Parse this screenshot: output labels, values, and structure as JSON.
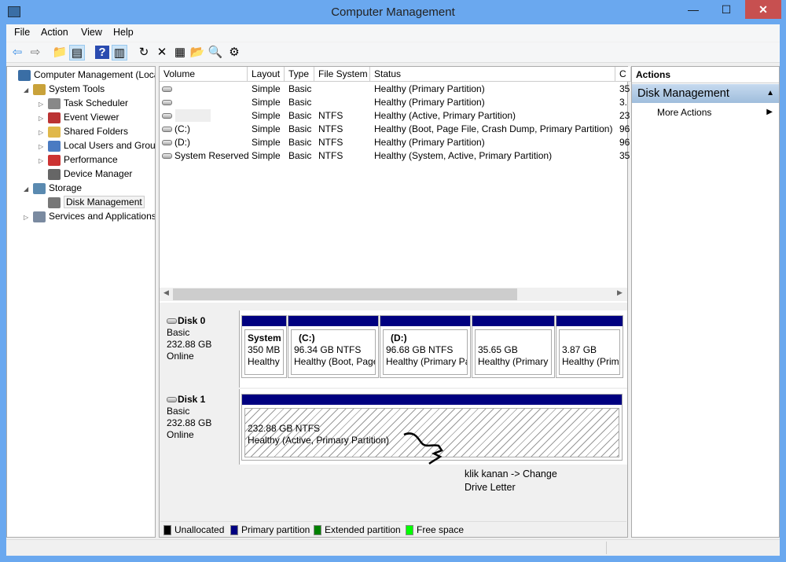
{
  "window": {
    "title": "Computer Management",
    "minimize": "—",
    "maximize": "☐",
    "close": "✕"
  },
  "menu": [
    "File",
    "Action",
    "View",
    "Help"
  ],
  "toolbar": [
    {
      "icon": "back-arrow-icon",
      "glyph": "⇦"
    },
    {
      "icon": "forward-arrow-icon",
      "glyph": "⇨"
    },
    {
      "icon": "up-folder-icon",
      "glyph": "📁"
    },
    {
      "icon": "show-hide-tree-icon",
      "glyph": "▤"
    },
    {
      "icon": "help-icon",
      "glyph": "?"
    },
    {
      "icon": "show-hide-action-pane-icon",
      "glyph": "▥"
    },
    {
      "icon": "refresh-icon",
      "glyph": "↻"
    },
    {
      "icon": "delete-icon",
      "glyph": "✕"
    },
    {
      "icon": "properties-icon",
      "glyph": "▦"
    },
    {
      "icon": "open-folder-icon",
      "glyph": "📂"
    },
    {
      "icon": "search-icon",
      "glyph": "🔍"
    },
    {
      "icon": "settings-icon",
      "glyph": "⚙"
    }
  ],
  "tree": [
    {
      "label": "Computer Management (Local",
      "level": 0,
      "tw": "",
      "icon": "computer-icon",
      "color": "#3a6ea5"
    },
    {
      "label": "System Tools",
      "level": 1,
      "tw": "◢",
      "icon": "tools-icon",
      "color": "#c9a23a"
    },
    {
      "label": "Task Scheduler",
      "level": 2,
      "tw": "▷",
      "icon": "clock-icon",
      "color": "#888"
    },
    {
      "label": "Event Viewer",
      "level": 2,
      "tw": "▷",
      "icon": "event-viewer-icon",
      "color": "#b33"
    },
    {
      "label": "Shared Folders",
      "level": 2,
      "tw": "▷",
      "icon": "shared-folder-icon",
      "color": "#e0b84a"
    },
    {
      "label": "Local Users and Groups",
      "level": 2,
      "tw": "▷",
      "icon": "users-icon",
      "color": "#4a7bc2"
    },
    {
      "label": "Performance",
      "level": 2,
      "tw": "▷",
      "icon": "performance-icon",
      "color": "#c33"
    },
    {
      "label": "Device Manager",
      "level": 2,
      "tw": "",
      "icon": "device-manager-icon",
      "color": "#666"
    },
    {
      "label": "Storage",
      "level": 1,
      "tw": "◢",
      "icon": "storage-icon",
      "color": "#5a8ab0"
    },
    {
      "label": "Disk Management",
      "level": 2,
      "tw": "",
      "icon": "disk-management-icon",
      "color": "#777",
      "selected": true
    },
    {
      "label": "Services and Applications",
      "level": 1,
      "tw": "▷",
      "icon": "services-icon",
      "color": "#7a8aa0"
    }
  ],
  "volumes": {
    "headers": [
      "Volume",
      "Layout",
      "Type",
      "File System",
      "Status",
      "C"
    ],
    "rows": [
      [
        "",
        "Simple",
        "Basic",
        "",
        "Healthy (Primary Partition)",
        "35"
      ],
      [
        "",
        "Simple",
        "Basic",
        "",
        "Healthy (Primary Partition)",
        "3."
      ],
      [
        "",
        "Simple",
        "Basic",
        "NTFS",
        "Healthy (Active, Primary Partition)",
        "23"
      ],
      [
        "(C:)",
        "Simple",
        "Basic",
        "NTFS",
        "Healthy (Boot, Page File, Crash Dump, Primary Partition)",
        "96"
      ],
      [
        "(D:)",
        "Simple",
        "Basic",
        "NTFS",
        "Healthy (Primary Partition)",
        "96"
      ],
      [
        "System Reserved",
        "Simple",
        "Basic",
        "NTFS",
        "Healthy (System, Active, Primary Partition)",
        "35"
      ]
    ]
  },
  "disks": [
    {
      "name": "Disk 0",
      "type": "Basic",
      "size": "232.88 GB",
      "state": "Online",
      "partitions": [
        {
          "title": "System",
          "size": "350 MB",
          "status": "Healthy"
        },
        {
          "title": "(C:)",
          "size": "96.34 GB NTFS",
          "status": "Healthy (Boot, Page"
        },
        {
          "title": "(D:)",
          "size": "96.68 GB NTFS",
          "status": "Healthy (Primary Pa"
        },
        {
          "title": "",
          "size": "35.65 GB",
          "status": "Healthy (Primary"
        },
        {
          "title": "",
          "size": "3.87 GB",
          "status": "Healthy (Prim"
        }
      ]
    },
    {
      "name": "Disk 1",
      "type": "Basic",
      "size": "232.88 GB",
      "state": "Online",
      "partitions": [
        {
          "title": "",
          "size": "232.88 GB NTFS",
          "status": "Healthy (Active, Primary Partition)"
        }
      ]
    }
  ],
  "annotation": {
    "line1": "klik kanan -> Change",
    "line2": "Drive Letter"
  },
  "legend": [
    {
      "label": "Unallocated",
      "color": "#000000"
    },
    {
      "label": "Primary partition",
      "color": "#000080"
    },
    {
      "label": "Extended partition",
      "color": "#008000"
    },
    {
      "label": "Free space",
      "color": "#00ff00"
    }
  ],
  "actions": {
    "header": "Actions",
    "section": "Disk Management",
    "item": "More Actions"
  }
}
